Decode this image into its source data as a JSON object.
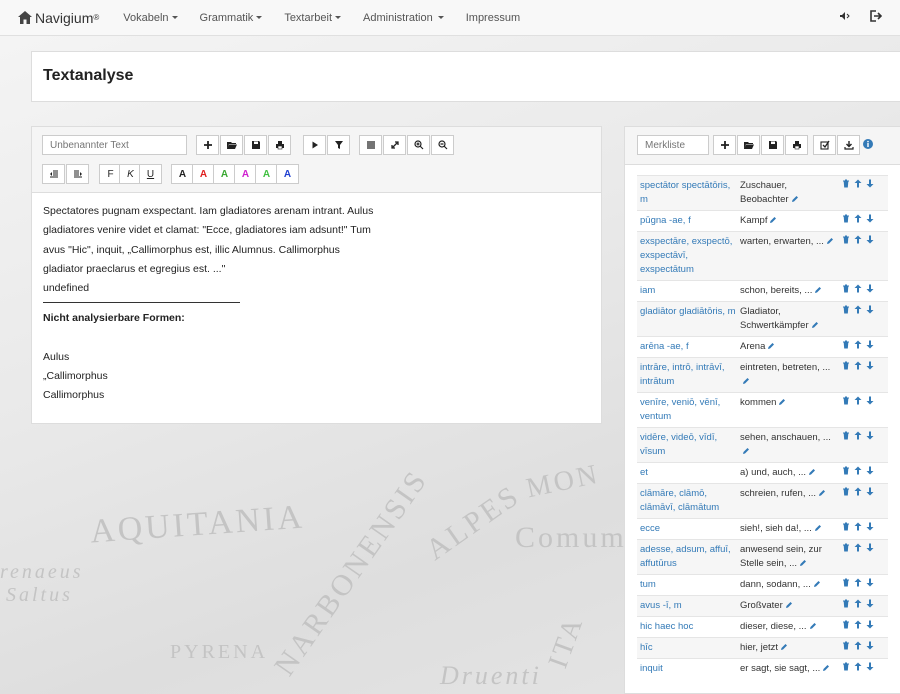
{
  "navbar": {
    "brand": "Navigium",
    "brand_mark": "®",
    "items": [
      {
        "label": "Vokabeln",
        "dropdown": true
      },
      {
        "label": "Grammatik",
        "dropdown": true
      },
      {
        "label": "Textarbeit",
        "dropdown": true
      },
      {
        "label": "Administration",
        "dropdown": true
      },
      {
        "label": "Impressum",
        "dropdown": false
      }
    ],
    "right_icons": [
      "volume-icon",
      "logout-icon"
    ]
  },
  "background_map": [
    "AQUITANIA",
    "NARBONENSIS",
    "ALPES",
    "MON",
    "Comum",
    "renaeus",
    "Saltus",
    "PYRENA",
    "ITA",
    "Druenti"
  ],
  "page_title": "Textanalyse",
  "editor": {
    "text_name_placeholder": "Unbenannter Text",
    "toolbar_row1": [
      "plus-icon",
      "folder-open-icon",
      "save-icon",
      "print-icon",
      "play-icon",
      "filter-icon",
      "list-icon",
      "expand-icon",
      "zoom-in-icon",
      "zoom-out-icon"
    ],
    "toolbar_row2": [
      {
        "name": "outdent-icon",
        "label": ""
      },
      {
        "name": "indent-icon",
        "label": ""
      },
      {
        "name": "bold-button",
        "label": "F"
      },
      {
        "name": "italic-button",
        "label": "K"
      },
      {
        "name": "underline-button",
        "label": "U"
      },
      {
        "name": "color-black-button",
        "label": "A",
        "color": "#222222"
      },
      {
        "name": "color-red-button",
        "label": "A",
        "color": "#e02020"
      },
      {
        "name": "color-green-button",
        "label": "A",
        "color": "#3aa832"
      },
      {
        "name": "color-magenta-button",
        "label": "A",
        "color": "#d020d0"
      },
      {
        "name": "color-lime-button",
        "label": "A",
        "color": "#40c040"
      },
      {
        "name": "color-blue-button",
        "label": "A",
        "color": "#2040d0"
      }
    ],
    "lines": [
      "Spectatores pugnam exspectant. Iam gladiatores arenam intrant. Aulus",
      "gladiatores venire videt et clamat: \"Ecce, gladiatores iam adsunt!\" Tum",
      "avus \"Hic\", inquit, „Callimorphus est, illic Alumnus. Callimorphus",
      "gladiator praeclarus et egregius est. ...\"",
      "undefined"
    ],
    "unanalyzable_heading": "Nicht analysierbare Formen:",
    "unanalyzable_forms": [
      "Aulus",
      "„Callimorphus",
      "Callimorphus"
    ]
  },
  "merkliste": {
    "placeholder": "Merkliste",
    "toolbar": [
      "plus-icon",
      "folder-open-icon",
      "save-icon",
      "print-icon",
      "check-icon",
      "download-icon",
      "info-icon"
    ],
    "rows": [
      {
        "lemma": "spectātor spectātōris, m",
        "meaning": "Zuschauer, Beobachter"
      },
      {
        "lemma": "pūgna -ae, f",
        "meaning": "Kampf"
      },
      {
        "lemma": "exspectāre, exspectō, exspectāvī, exspectātum",
        "meaning": "warten, erwarten, ..."
      },
      {
        "lemma": "iam",
        "meaning": "schon, bereits, ..."
      },
      {
        "lemma": "gladiātor gladiātōris, m",
        "meaning": "Gladiator, Schwertkämpfer"
      },
      {
        "lemma": "arēna -ae, f",
        "meaning": "Arena"
      },
      {
        "lemma": "intrāre, intrō, intrāvī, intrātum",
        "meaning": "eintreten, betreten, ..."
      },
      {
        "lemma": "venīre, veniō, vēnī, ventum",
        "meaning": "kommen"
      },
      {
        "lemma": "vidēre, videō, vīdī, vīsum",
        "meaning": "sehen, anschauen, ..."
      },
      {
        "lemma": "et",
        "meaning": "a) und, auch, ..."
      },
      {
        "lemma": "clāmāre, clāmō, clāmāvī, clāmātum",
        "meaning": "schreien, rufen, ..."
      },
      {
        "lemma": "ecce",
        "meaning": "sieh!, sieh da!, ..."
      },
      {
        "lemma": "adesse, adsum, affuī, affutūrus",
        "meaning": "anwesend sein, zur Stelle sein, ..."
      },
      {
        "lemma": "tum",
        "meaning": "dann, sodann, ..."
      },
      {
        "lemma": "avus -ī, m",
        "meaning": "Großvater"
      },
      {
        "lemma": "hic haec hoc",
        "meaning": "dieser, diese, ..."
      },
      {
        "lemma": "hīc",
        "meaning": "hier, jetzt"
      },
      {
        "lemma": "inquit",
        "meaning": "er sagt, sie sagt, ..."
      }
    ]
  }
}
